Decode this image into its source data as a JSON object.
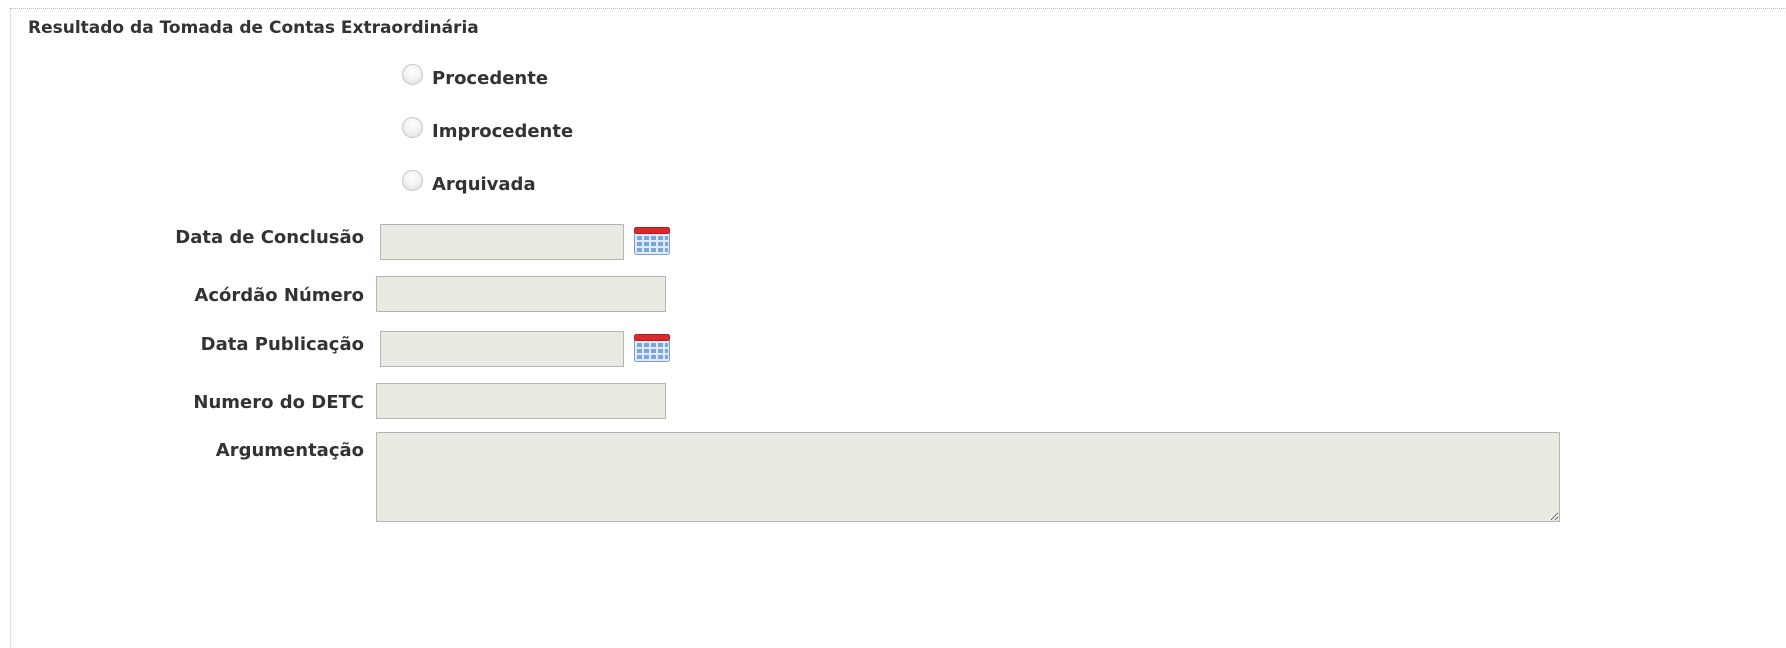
{
  "section": {
    "title": "Resultado da Tomada de Contas Extraordinária"
  },
  "radio_options": [
    {
      "label": "Procedente",
      "selected": false
    },
    {
      "label": "Improcedente",
      "selected": false
    },
    {
      "label": "Arquivada",
      "selected": false
    }
  ],
  "fields": {
    "data_conclusao": {
      "label": "Data de Conclusão",
      "value": ""
    },
    "acordao_numero": {
      "label": "Acórdão Número",
      "value": ""
    },
    "data_publicacao": {
      "label": "Data Publicação",
      "value": ""
    },
    "numero_detc": {
      "label": "Numero do DETC",
      "value": ""
    },
    "argumentacao": {
      "label": "Argumentação",
      "value": ""
    }
  },
  "icons": {
    "calendar": "calendar-icon"
  },
  "colors": {
    "input_background": "#eaeae3",
    "input_border": "#b5b5b5",
    "panel_border": "#a9c4dd",
    "calendar_header": "#d9292b",
    "calendar_body": "#7aa6e0"
  }
}
